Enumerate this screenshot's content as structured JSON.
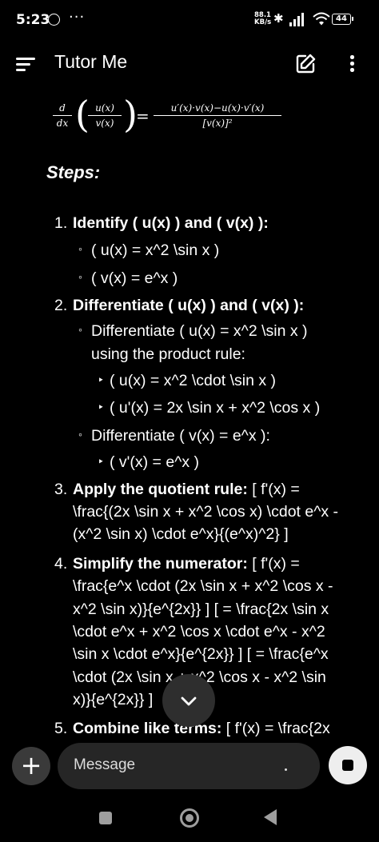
{
  "status_bar": {
    "time": "5:23",
    "more": "···",
    "net_speed_value": "88.1",
    "net_speed_unit": "KB/s",
    "battery": "44"
  },
  "app_bar": {
    "title": "Tutor Me"
  },
  "formula": {
    "d_num": "d",
    "d_den": "dx",
    "inner_num": "u(x)",
    "inner_den": "v(x)",
    "equals": "=",
    "rhs_num": "u′(x)·v(x)−u(x)·v′(x)",
    "rhs_den": "[v(x)]²"
  },
  "steps_heading": "Steps:",
  "steps": [
    {
      "number": "1.",
      "title": "Identify ( u(x) ) and ( v(x) ):"
    },
    {
      "number": "2.",
      "title": "Differentiate ( u(x) ) and ( v(x) ):"
    },
    {
      "number": "3.",
      "title": "Apply the quotient rule:",
      "text_l1": " [ f'(x) =",
      "text_l2": "\\frac{(2x \\sin x + x^2 \\cos x) \\cdot e^x -",
      "text_l3": "(x^2 \\sin x) \\cdot e^x}{(e^x)^2} ]"
    },
    {
      "number": "4.",
      "title": "Simplify the numerator:",
      "text_l1": " [ f'(x) =",
      "text_l2": "\\frac{e^x \\cdot (2x \\sin x + x^2 \\cos x -",
      "text_l3": "x^2 \\sin x)}{e^{2x}} ] [ = \\frac{2x \\sin x",
      "text_l4": "\\cdot e^x + x^2 \\cos x \\cdot e^x - x^2",
      "text_l5": "\\sin x \\cdot e^x}{e^{2x}} ] [ = \\frac{e^x",
      "text_l6": "\\cdot (2x \\sin x + x^2 \\cos x - x^2 \\sin",
      "text_l7": "x)}{e^{2x}} ]"
    },
    {
      "number": "5.",
      "title": "Combine like terms:",
      "text_l1": " [ f'(x) = \\frac{2x"
    }
  ],
  "sub": {
    "s1_a": "( u(x) = x^2 \\sin x )",
    "s1_b": "( v(x) = e^x )",
    "s2_a_l1": "Differentiate ( u(x) = x^2 \\sin x )",
    "s2_a_l2": "using the product rule:",
    "s2_a_i": "( u(x) = x^2 \\cdot \\sin x )",
    "s2_a_ii": "( u'(x) = 2x \\sin x + x^2 \\cos x )",
    "s2_b": "Differentiate ( v(x) = e^x ):",
    "s2_b_i": "( v'(x) = e^x )"
  },
  "bullets": {
    "hollow": "◦",
    "triangle": "‣"
  },
  "composer": {
    "placeholder": "Message",
    "add_symbol": "+"
  }
}
